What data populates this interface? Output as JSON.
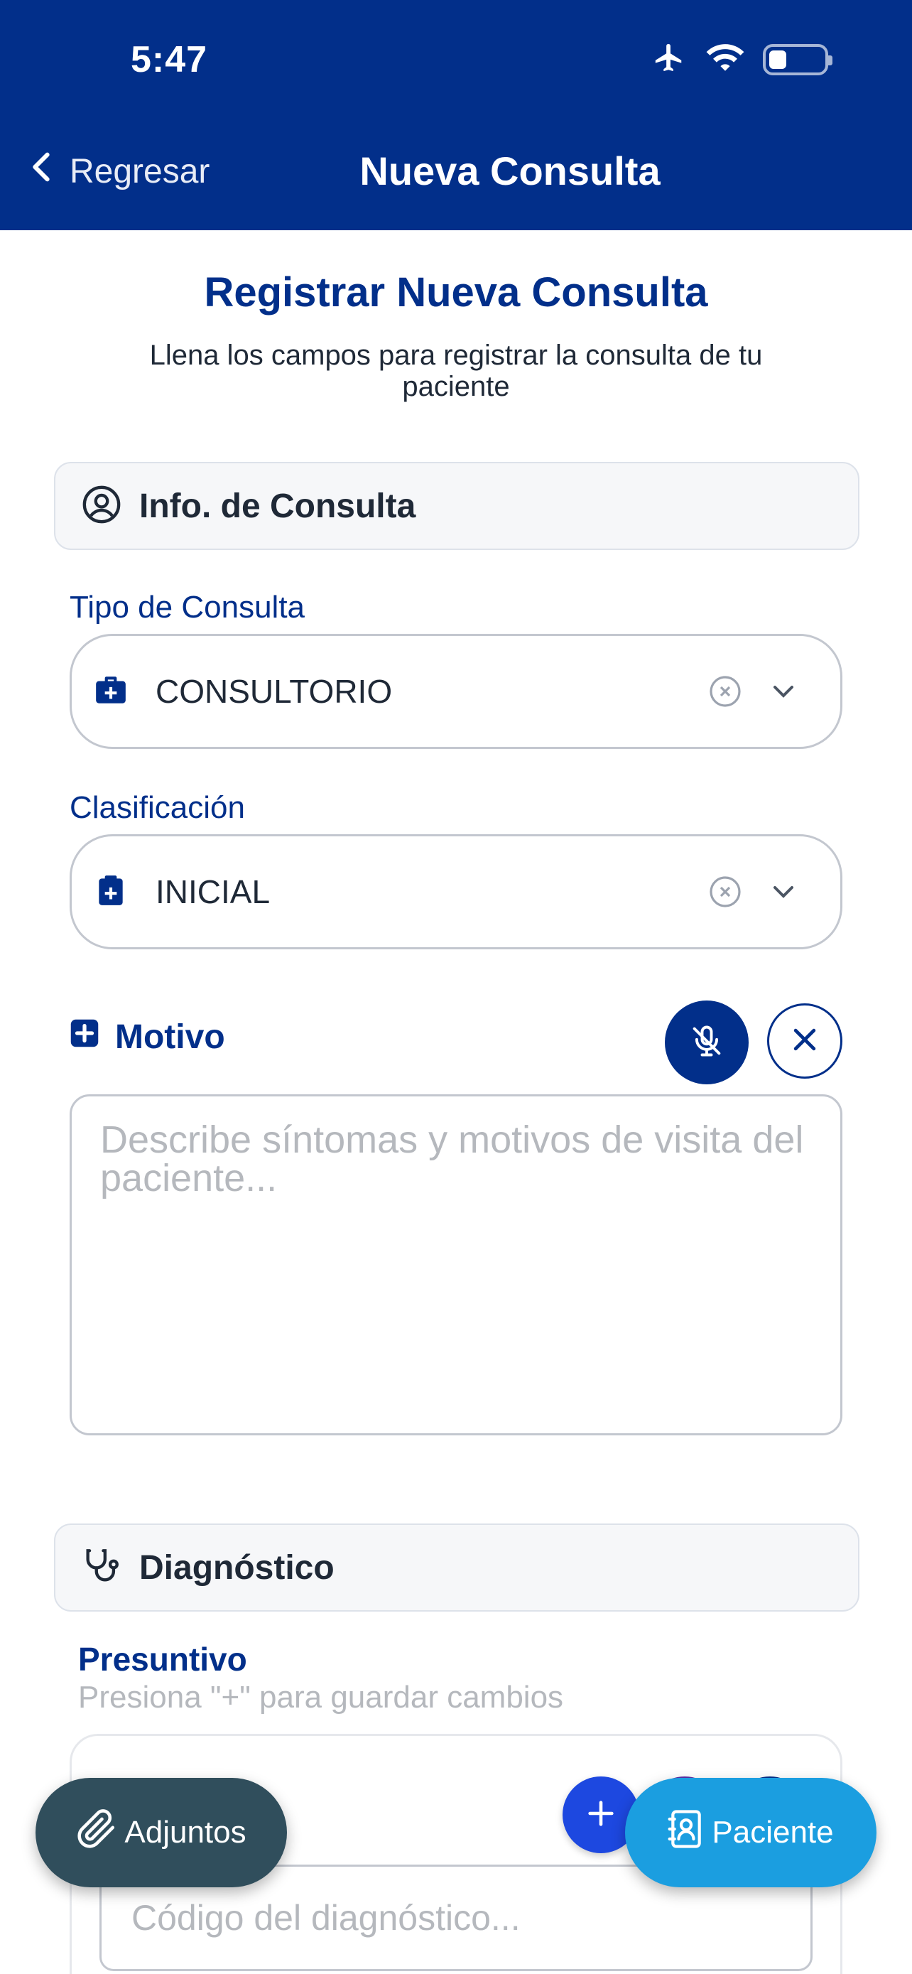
{
  "status": {
    "time": "5:47"
  },
  "nav": {
    "back_label": "Regresar",
    "title": "Nueva Consulta"
  },
  "page": {
    "title": "Registrar Nueva Consulta",
    "subtitle": "Llena los campos para registrar la consulta de tu paciente"
  },
  "consulta": {
    "section_title": "Info. de Consulta",
    "tipo": {
      "label": "Tipo de Consulta",
      "value": "CONSULTORIO"
    },
    "clasificacion": {
      "label": "Clasificación",
      "value": "INICIAL"
    },
    "motivo": {
      "label": "Motivo",
      "value": "",
      "placeholder": "Describe síntomas y motivos de visita del paciente..."
    }
  },
  "diagnostico": {
    "section_title": "Diagnóstico",
    "presuntivo_label": "Presuntivo",
    "hint": "Presiona \"+\" para guardar cambios",
    "code_placeholder": "Código del diagnóstico..."
  },
  "fabs": {
    "adjuntos_label": "Adjuntos",
    "paciente_label": "Paciente"
  },
  "colors": {
    "primary": "#022f8a",
    "add_button": "#1d48e0",
    "adjuntos_fab": "#304e5c",
    "paciente_fab": "#1b9ee0"
  },
  "icons": {
    "airplane": "airplane-icon",
    "wifi": "wifi-icon",
    "battery": "battery-icon",
    "back": "chevron-left-icon",
    "user_circle": "user-circle-icon",
    "medkit": "medical-bag-icon",
    "clipboard": "clipboard-plus-icon",
    "clear": "clear-circle-icon",
    "chevron": "chevron-down-icon",
    "plus_square": "plus-square-icon",
    "mic_off": "microphone-off-icon",
    "close": "close-icon",
    "stethoscope": "stethoscope-icon",
    "plus": "plus-icon",
    "paperclip": "paperclip-icon",
    "contact_book": "contact-book-icon"
  }
}
